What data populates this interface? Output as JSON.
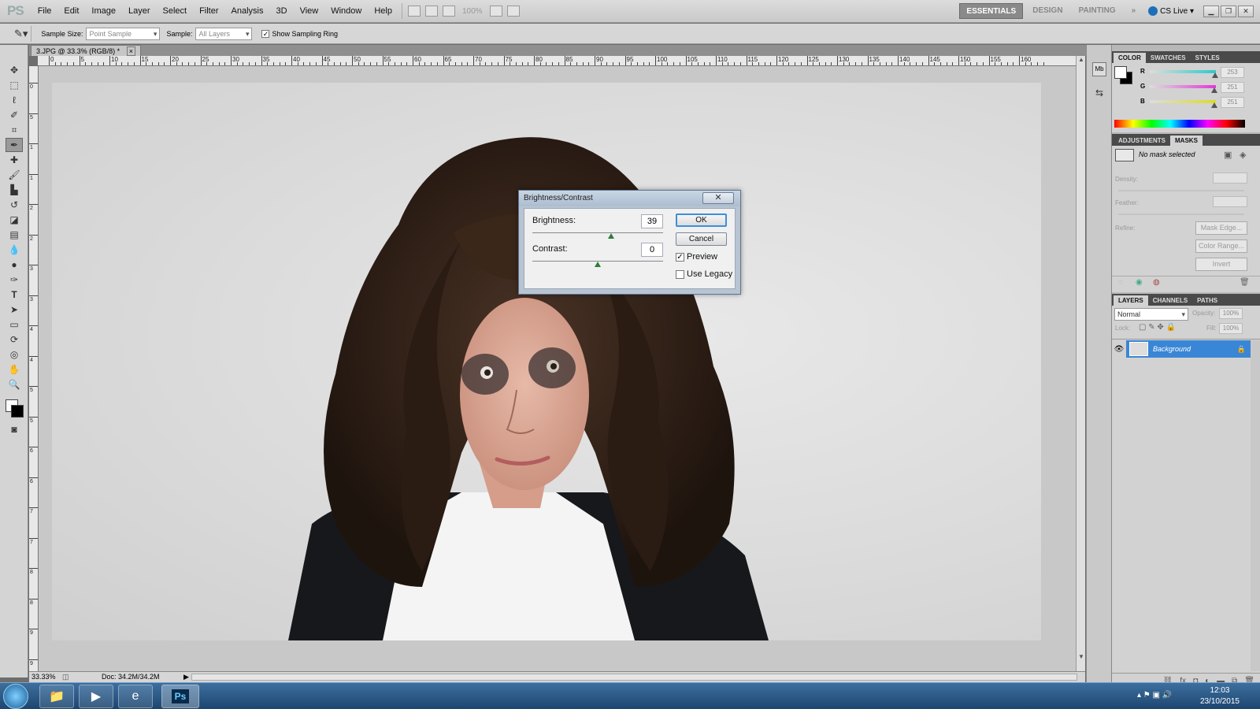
{
  "app": {
    "logo": "PS"
  },
  "menu": [
    "File",
    "Edit",
    "Image",
    "Layer",
    "Select",
    "Filter",
    "Analysis",
    "3D",
    "View",
    "Window",
    "Help"
  ],
  "menubar": {
    "zoom": "100%"
  },
  "workspaces": {
    "items": [
      "ESSENTIALS",
      "DESIGN",
      "PAINTING"
    ],
    "more": "»",
    "cslive": "CS Live"
  },
  "options": {
    "sample_size_label": "Sample Size:",
    "sample_size_value": "Point Sample",
    "sample_label": "Sample:",
    "sample_value": "All Layers",
    "show_ring_label": "Show Sampling Ring",
    "show_ring_checked": "✓"
  },
  "document": {
    "tab_title": "3.JPG @ 33.3% (RGB/8) *",
    "tab_close": "×",
    "zoom": "33.33%",
    "doc_size": "Doc: 34.2M/34.2M"
  },
  "ruler_h": [
    "0",
    "5",
    "10",
    "15",
    "20",
    "25",
    "30",
    "35",
    "40",
    "45",
    "50",
    "55",
    "60",
    "65",
    "70",
    "75",
    "80",
    "85",
    "90",
    "95",
    "100",
    "105",
    "110",
    "115",
    "120",
    "125",
    "130",
    "135",
    "140",
    "145",
    "150",
    "155",
    "160"
  ],
  "ruler_v": [
    "0",
    "5",
    "1",
    "1",
    "2",
    "2",
    "3",
    "3",
    "4",
    "4",
    "5",
    "5",
    "6",
    "6",
    "7",
    "7",
    "8",
    "8",
    "9",
    "9",
    "1"
  ],
  "color_panel": {
    "tabs": [
      "COLOR",
      "SWATCHES",
      "STYLES"
    ],
    "channels": [
      {
        "label": "R",
        "value": "253",
        "color": "#2fc9c9",
        "level": 0.99
      },
      {
        "label": "G",
        "value": "251",
        "color": "#e23ad8",
        "level": 0.98
      },
      {
        "label": "B",
        "value": "251",
        "color": "#dcdc2a",
        "level": 0.98
      }
    ]
  },
  "masks_panel": {
    "tabs": [
      "ADJUSTMENTS",
      "MASKS"
    ],
    "no_mask": "No mask selected",
    "density_label": "Density:",
    "feather_label": "Feather:",
    "refine_label": "Refine:",
    "mask_edge": "Mask Edge...",
    "color_range": "Color Range...",
    "invert": "Invert"
  },
  "layers_panel": {
    "tabs": [
      "LAYERS",
      "CHANNELS",
      "PATHS"
    ],
    "blend_mode": "Normal",
    "opacity_label": "Opacity:",
    "opacity_value": "100%",
    "lock_label": "Lock:",
    "fill_label": "Fill:",
    "fill_value": "100%",
    "layer_name": "Background"
  },
  "dialog": {
    "title": "Brightness/Contrast",
    "close": "✕",
    "brightness_label": "Brightness:",
    "brightness_value": "39",
    "brightness_level": 0.6,
    "contrast_label": "Contrast:",
    "contrast_value": "0",
    "contrast_level": 0.5,
    "ok": "OK",
    "cancel": "Cancel",
    "preview_label": "Preview",
    "preview_check": "✓",
    "legacy_label": "Use Legacy",
    "legacy_check": ""
  },
  "taskbar": {
    "time": "12:03",
    "date": "23/10/2015"
  }
}
